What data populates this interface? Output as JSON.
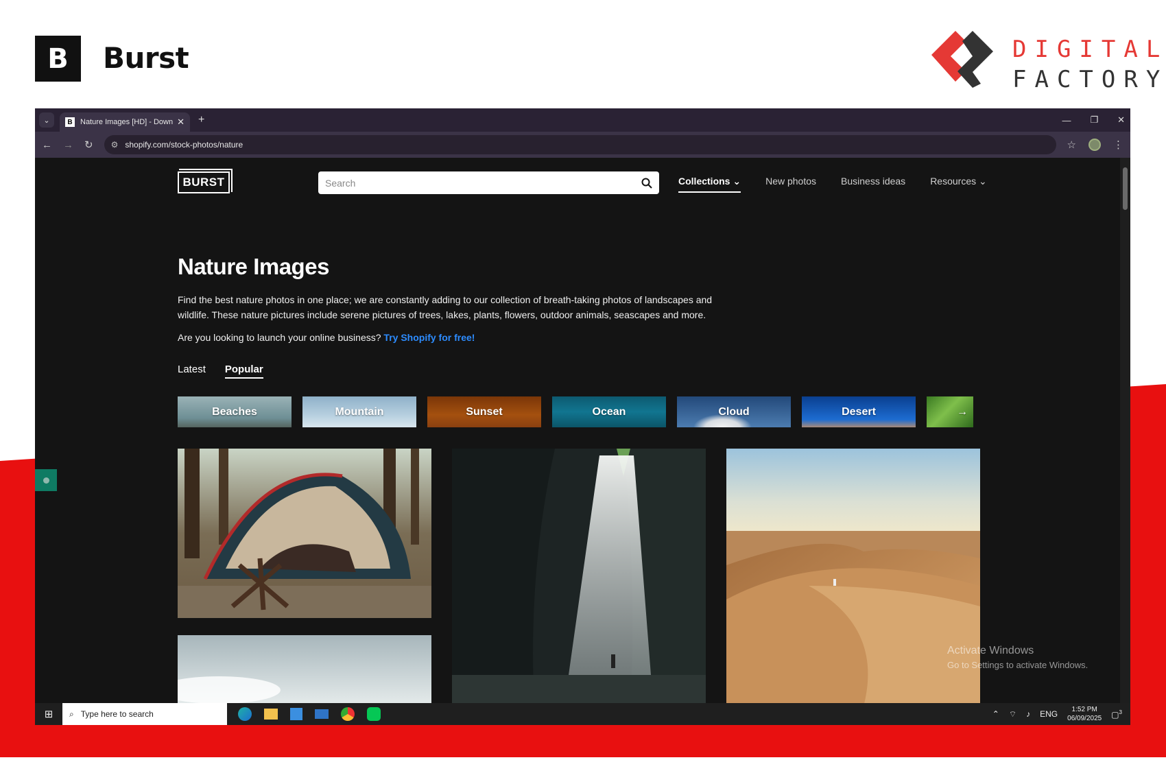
{
  "slide": {
    "brand_letter": "B",
    "brand_name": "Burst",
    "partner_line1": "DIGITAL",
    "partner_line2": "FACTORY",
    "accent_red": "#e81010"
  },
  "browser": {
    "tab_title": "Nature Images [HD] - Download",
    "tab_favicon": "B",
    "url": "shopify.com/stock-photos/nature"
  },
  "site": {
    "logo": "BURST",
    "search_placeholder": "Search",
    "nav": [
      {
        "label": "Collections ⌄"
      },
      {
        "label": "New photos"
      },
      {
        "label": "Business ideas"
      },
      {
        "label": "Resources ⌄"
      }
    ],
    "title": "Nature Images",
    "description": "Find the best nature photos in one place; we are constantly adding to our collection of breath-taking photos of landscapes and wildlife. These nature pictures include serene pictures of trees, lakes, plants, flowers, outdoor animals, seascapes and more.",
    "cta_text": "Are you looking to launch your online business? ",
    "cta_link": "Try Shopify for free!",
    "tabs": [
      "Latest",
      "Popular"
    ],
    "categories": [
      {
        "label": "Beaches"
      },
      {
        "label": "Mountain"
      },
      {
        "label": "Sunset"
      },
      {
        "label": "Ocean"
      },
      {
        "label": "Cloud"
      },
      {
        "label": "Desert"
      },
      {
        "label": "→"
      }
    ]
  },
  "watermark": {
    "line1": "Activate Windows",
    "line2": "Go to Settings to activate Windows."
  },
  "taskbar": {
    "search_placeholder": "Type here to search",
    "lang": "ENG",
    "time": "1:52 PM",
    "date": "06/09/2025",
    "notifications": "3"
  }
}
